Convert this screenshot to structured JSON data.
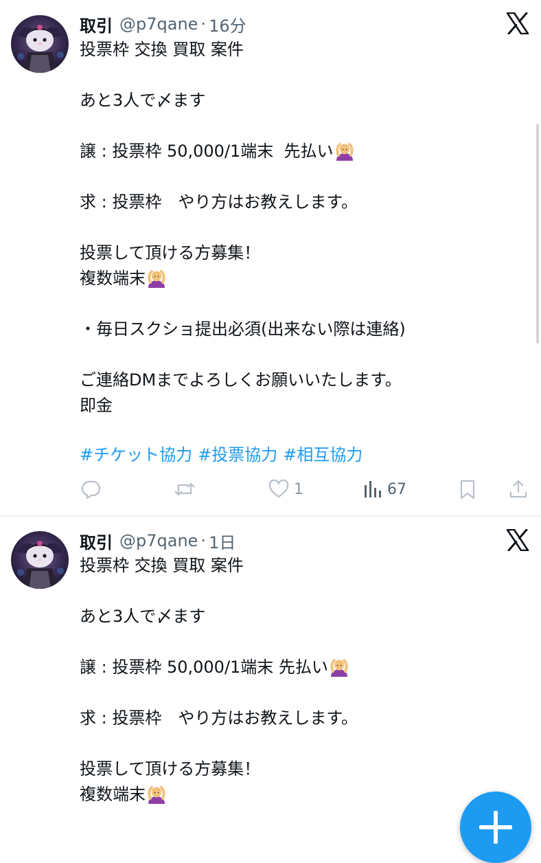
{
  "tweets": [
    {
      "display_name": "取引",
      "handle": "@p7qane",
      "separator": "·",
      "time": "16分",
      "lines": [
        "投票枠 交換 買取 案件",
        "",
        "あと3人で〆ます",
        "",
        "譲 : 投票枠 50,000/1端末  先払い",
        "",
        "求 : 投票枠　やり方はお教えします。",
        "",
        "投票して頂ける方募集！",
        "複数端末",
        "",
        "・毎日スクショ提出必須(出来ない際は連絡)",
        "",
        "ご連絡DMまでよろしくお願いいたします。",
        "即金"
      ],
      "hashtags": [
        "#チケット協力",
        "#投票協力",
        "#相互協力"
      ],
      "actions": {
        "reply_icon": "reply-icon",
        "retweet_icon": "retweet-icon",
        "like_icon": "heart-icon",
        "like_count": "1",
        "views_icon": "views-bar-icon",
        "views_count": "67",
        "bookmark_icon": "bookmark-icon",
        "share_icon": "share-icon"
      }
    },
    {
      "display_name": "取引",
      "handle": "@p7qane",
      "separator": "·",
      "time": "1日",
      "lines": [
        "投票枠 交換 買取 案件",
        "",
        "あと3人で〆ます",
        "",
        "譲 : 投票枠 50,000/1端末 先払い",
        "",
        "求 : 投票枠　やり方はお教えします。",
        "",
        "投票して頂ける方募集！",
        "複数端末"
      ]
    }
  ],
  "emoji": "person-gesturing-ok-emoji",
  "platform_icon": "x-logo-icon",
  "fab_icon": "plus-icon",
  "colors": {
    "text": "#0f1419",
    "secondary": "#536471",
    "accent": "#1d9bf0",
    "action_gray": "#8b98a5",
    "divider": "#eff3f4"
  }
}
